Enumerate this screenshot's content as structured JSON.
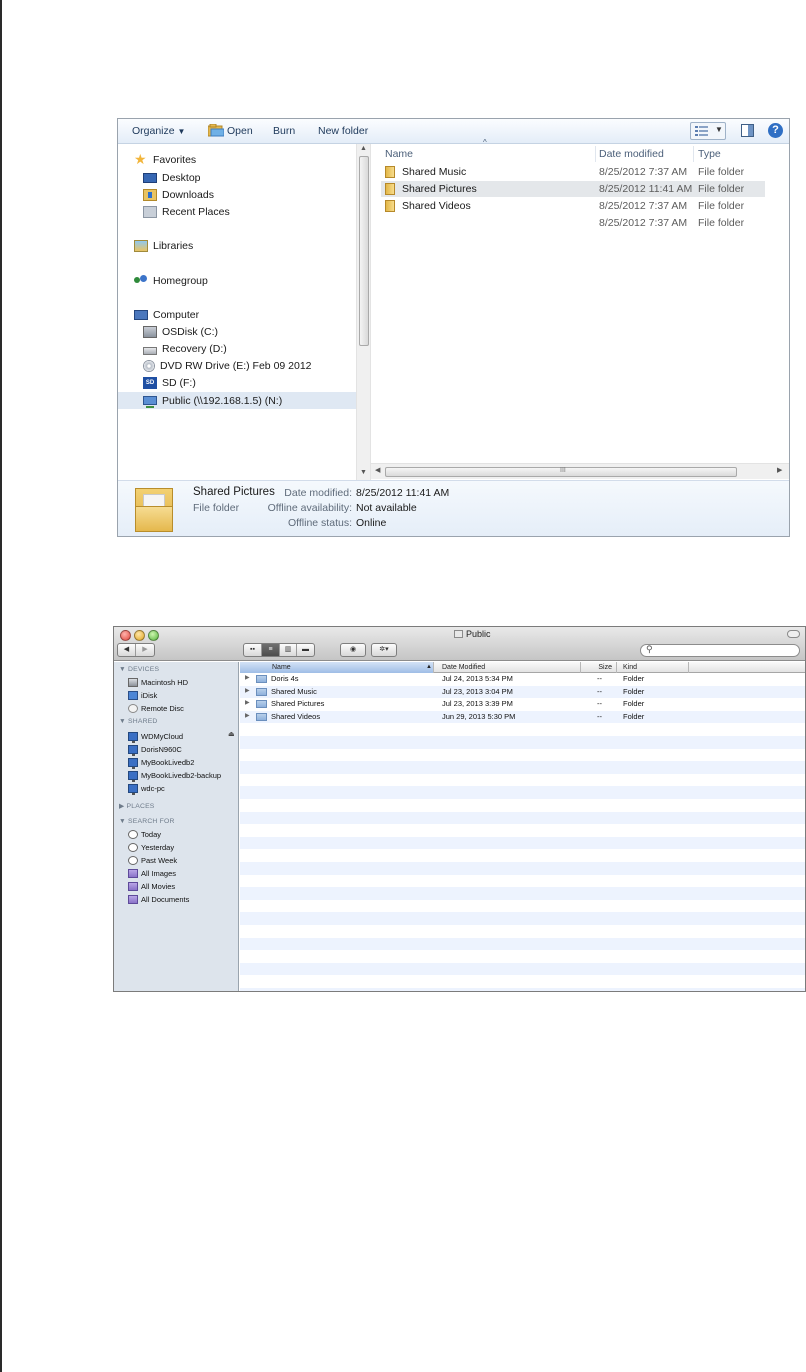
{
  "windows_explorer": {
    "toolbar": {
      "organize": "Organize",
      "open": "Open",
      "burn": "Burn",
      "new_folder": "New folder"
    },
    "nav": {
      "favorites": "Favorites",
      "desktop": "Desktop",
      "downloads": "Downloads",
      "recent_places": "Recent Places",
      "libraries": "Libraries",
      "homegroup": "Homegroup",
      "computer": "Computer",
      "drives": [
        "OSDisk (C:)",
        "Recovery (D:)",
        "DVD RW Drive (E:) Feb 09 2012",
        "SD (F:)",
        "Public (\\\\192.168.1.5) (N:)"
      ]
    },
    "columns": {
      "name": "Name",
      "date_modified": "Date modified",
      "type": "Type"
    },
    "files": [
      {
        "name": "Shared Music",
        "date": "8/25/2012 7:37 AM",
        "type": "File folder"
      },
      {
        "name": "Shared Pictures",
        "date": "8/25/2012 11:41 AM",
        "type": "File folder"
      },
      {
        "name": "Shared Videos",
        "date": "8/25/2012 7:37 AM",
        "type": "File folder"
      },
      {
        "name": "",
        "date": "8/25/2012 7:37 AM",
        "type": "File folder"
      }
    ],
    "scroll_grip": "III",
    "details": {
      "name": "Shared Pictures",
      "kind": "File folder",
      "date_label": "Date modified:",
      "date_value": "8/25/2012 11:41 AM",
      "offline_label": "Offline availability:",
      "offline_value": "Not available",
      "status_label": "Offline status:",
      "status_value": "Online"
    }
  },
  "mac_finder": {
    "title": "Public",
    "search_placeholder": "",
    "sidebar": {
      "devices_head": "▼ DEVICES",
      "devices": [
        "Macintosh HD",
        "iDisk",
        "Remote Disc"
      ],
      "shared_head": "▼ SHARED",
      "shared": [
        "WDMyCloud",
        "DorisN960C",
        "MyBookLivedb2",
        "MyBookLivedb2-backup",
        "wdc-pc"
      ],
      "places_head": "▶ PLACES",
      "search_head": "▼ SEARCH FOR",
      "search_for": [
        "Today",
        "Yesterday",
        "Past Week",
        "All Images",
        "All Movies",
        "All Documents"
      ]
    },
    "columns": {
      "name": "Name",
      "date_modified": "Date Modified",
      "size": "Size",
      "kind": "Kind"
    },
    "rows": [
      {
        "name": "Doris 4s",
        "date": "Jul 24, 2013 5:34 PM",
        "size": "--",
        "kind": "Folder"
      },
      {
        "name": "Shared Music",
        "date": "Jul 23, 2013 3:04 PM",
        "size": "--",
        "kind": "Folder"
      },
      {
        "name": "Shared Pictures",
        "date": "Jul 23, 2013 3:39 PM",
        "size": "--",
        "kind": "Folder"
      },
      {
        "name": "Shared Videos",
        "date": "Jun 29, 2013 5:30 PM",
        "size": "--",
        "kind": "Folder"
      }
    ]
  }
}
